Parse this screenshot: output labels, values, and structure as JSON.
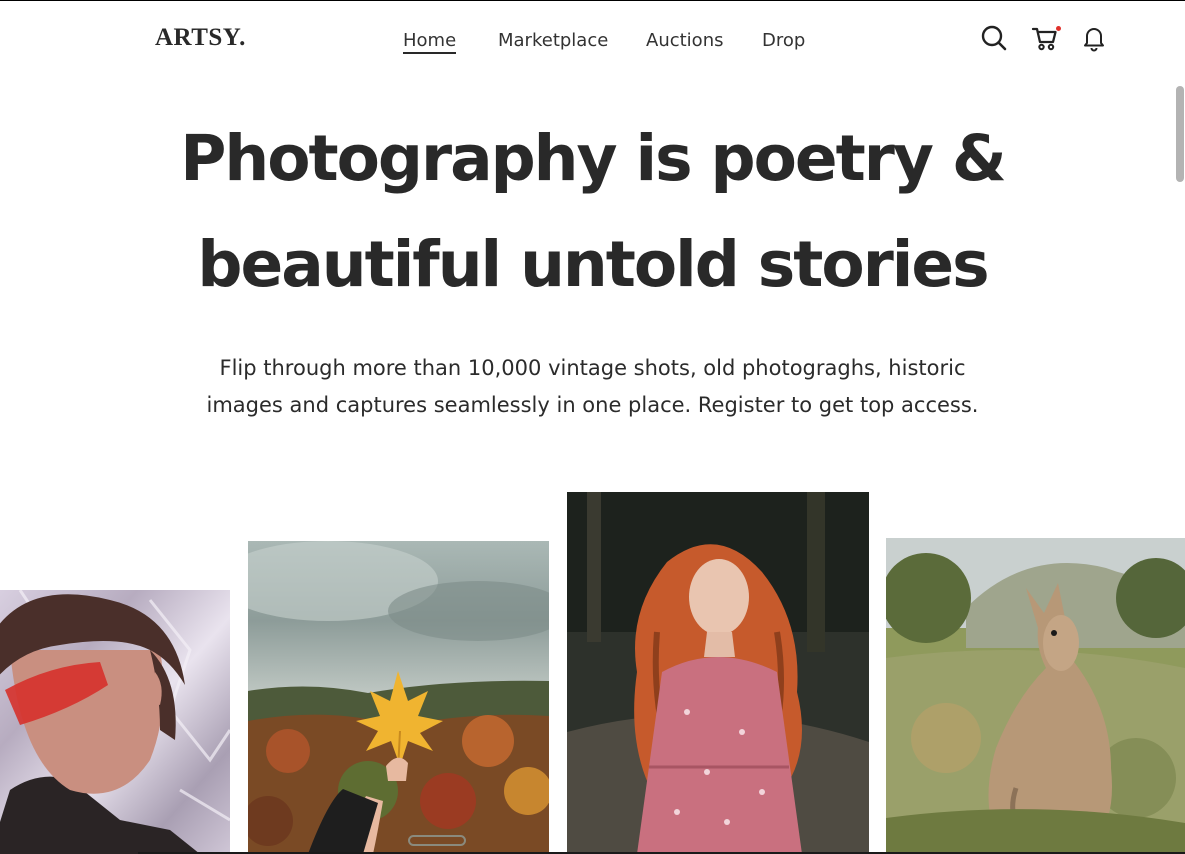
{
  "brand": {
    "logo": "ARTSY."
  },
  "nav": {
    "items": [
      {
        "label": "Home",
        "active": true
      },
      {
        "label": "Marketplace",
        "active": false
      },
      {
        "label": "Auctions",
        "active": false
      },
      {
        "label": "Drop",
        "active": false
      }
    ]
  },
  "header_icons": [
    "search-icon",
    "cart-icon",
    "bell-icon"
  ],
  "hero": {
    "title_line1": "Photography is poetry &",
    "title_line2": "beautiful untold stories",
    "subtitle_line1": "Flip through more than 10,000 vintage shots, old photograghs, historic",
    "subtitle_line2": "images and captures seamlessly in one place. Register to get top access."
  },
  "gallery": [
    {
      "name": "person-red-glasses-photo"
    },
    {
      "name": "autumn-leaf-landscape-photo"
    },
    {
      "name": "red-haired-woman-photo"
    },
    {
      "name": "kangaroo-photo"
    }
  ],
  "colors": {
    "text": "#292929",
    "notification_dot": "#e0312b",
    "background": "#ffffff"
  }
}
